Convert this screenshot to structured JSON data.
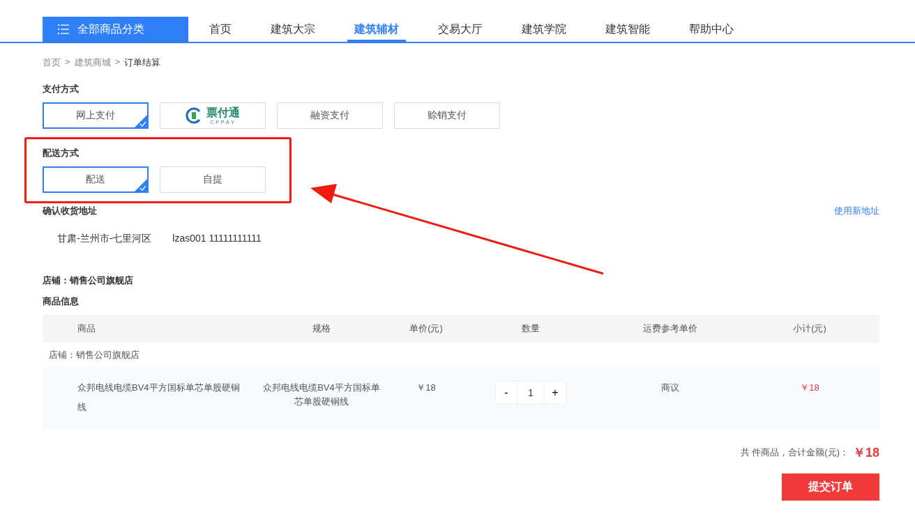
{
  "nav": {
    "category_button": "全部商品分类",
    "items": [
      {
        "label": "首页",
        "selected": false
      },
      {
        "label": "建筑大宗",
        "selected": false
      },
      {
        "label": "建筑辅材",
        "selected": true
      },
      {
        "label": "交易大厅",
        "selected": false
      },
      {
        "label": "建筑学院",
        "selected": false
      },
      {
        "label": "建筑智能",
        "selected": false
      },
      {
        "label": "帮助中心",
        "selected": false
      }
    ]
  },
  "breadcrumb": [
    {
      "label": "首页",
      "current": false
    },
    {
      "label": "建筑商城",
      "current": false
    },
    {
      "label": "订单结算",
      "current": true
    }
  ],
  "breadcrumb_separator": ">",
  "payment": {
    "title": "支付方式",
    "options": [
      {
        "kind": "text",
        "label": "网上支付",
        "selected": true
      },
      {
        "kind": "logo",
        "label": "票付通",
        "sublabel": "CPPAY",
        "selected": false
      },
      {
        "kind": "text",
        "label": "融资支付",
        "selected": false
      },
      {
        "kind": "text",
        "label": "赊销支付",
        "selected": false
      }
    ]
  },
  "delivery": {
    "title": "配送方式",
    "options": [
      {
        "kind": "text",
        "label": "配送",
        "selected": true
      },
      {
        "kind": "text",
        "label": "自提",
        "selected": false
      }
    ]
  },
  "address": {
    "title": "确认收货地址",
    "new_link": "使用新地址",
    "region": "甘肃-兰州市-七里河区",
    "contact": "lzas001 11111111111"
  },
  "shop_label": "店铺：销售公司旗舰店",
  "goods_title": "商品信息",
  "table": {
    "columns": [
      "商品",
      "规格",
      "单价(元)",
      "数量",
      "运费参考单价",
      "小计(元)"
    ],
    "shop_row": "店铺：销售公司旗舰店",
    "rows": [
      {
        "name": "众邦电线电缆BV4平方国标单芯单股硬铜线",
        "spec": "众邦电线电缆BV4平方国标单芯单股硬铜线",
        "price": "￥18",
        "minus": "-",
        "quantity": "1",
        "plus": "+",
        "freight": "商议",
        "subtotal": "￥18"
      }
    ]
  },
  "summary": {
    "label": "共 件商品，合计金额(元)：",
    "total": "￥18"
  },
  "submit_button": "提交订单"
}
